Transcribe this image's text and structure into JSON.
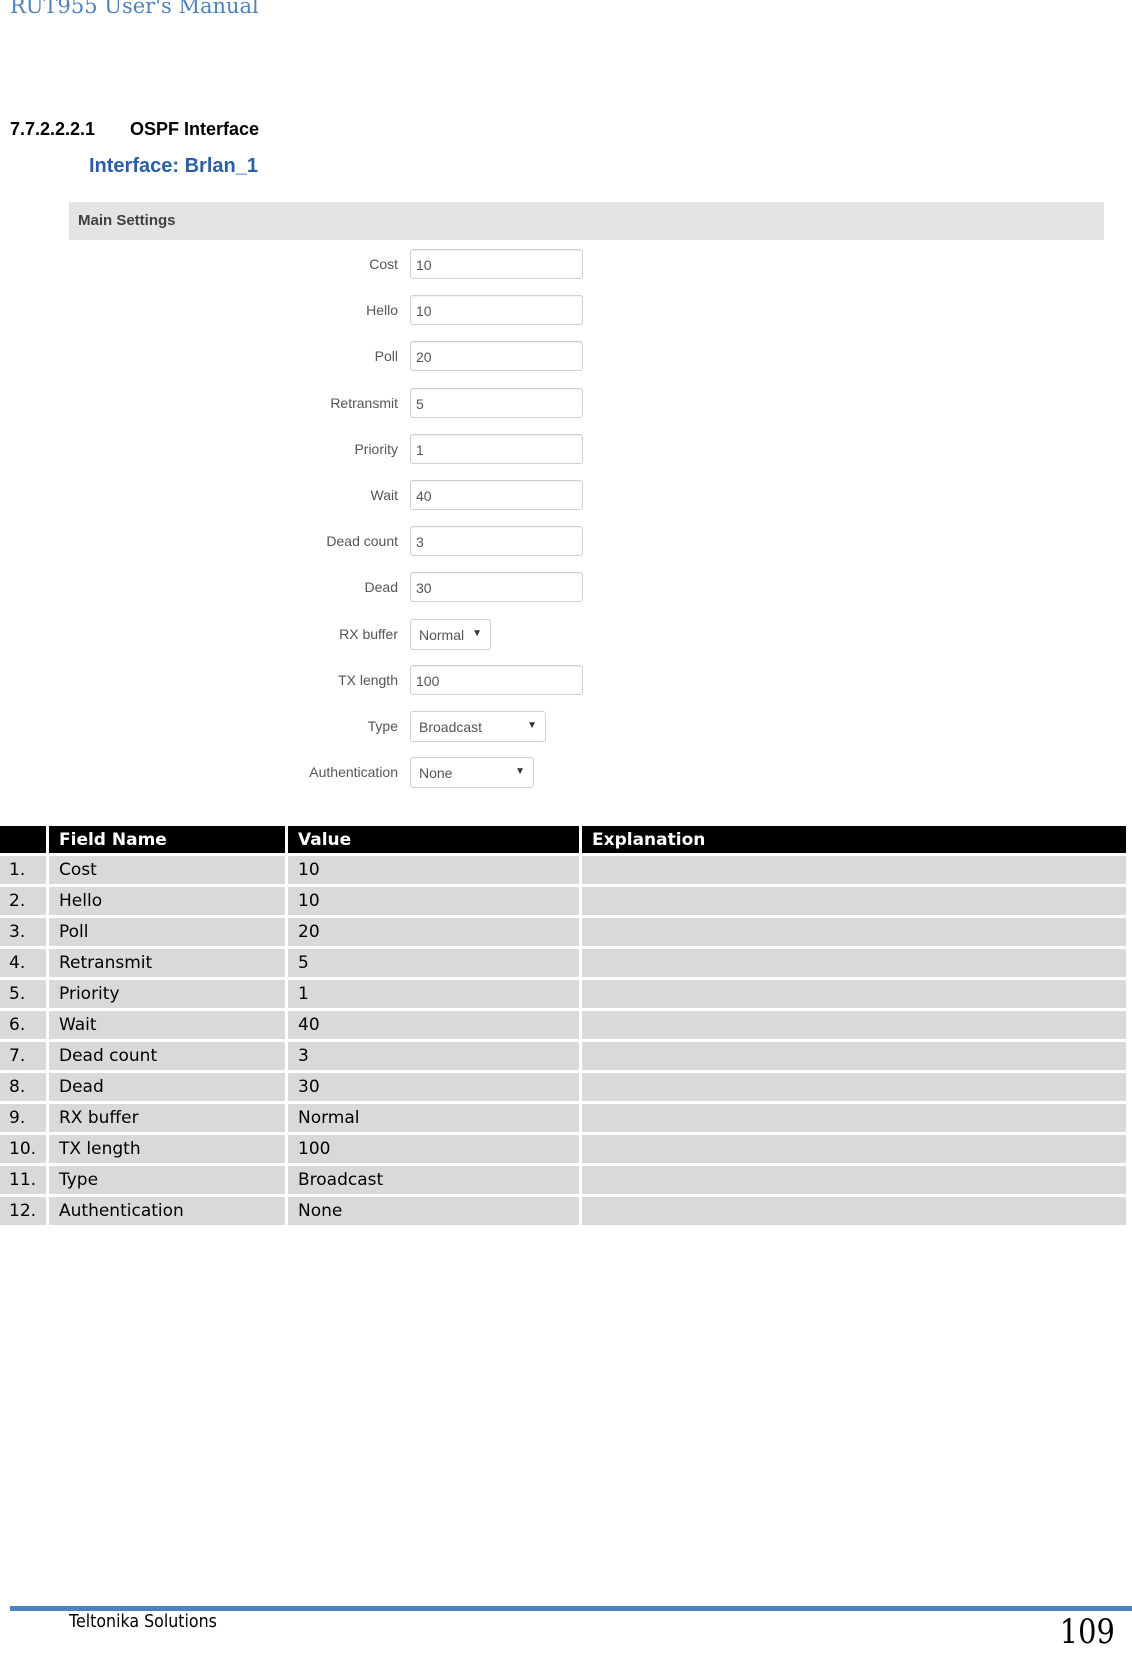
{
  "document": {
    "header_title": "RUT955 User's Manual",
    "footer_company": "Teltonika Solutions",
    "page_number": "109",
    "accent_color": "#4f81bd"
  },
  "section": {
    "number": "7.7.2.2.2.1",
    "title": "OSPF Interface"
  },
  "screenshot": {
    "title": "Interface: Brlan_1",
    "title_color": "#2a5ea8",
    "panel_title": "Main Settings",
    "fields": [
      {
        "label": "Cost",
        "value": "10",
        "kind": "input"
      },
      {
        "label": "Hello",
        "value": "10",
        "kind": "input"
      },
      {
        "label": "Poll",
        "value": "20",
        "kind": "input"
      },
      {
        "label": "Retransmit",
        "value": "5",
        "kind": "input"
      },
      {
        "label": "Priority",
        "value": "1",
        "kind": "input"
      },
      {
        "label": "Wait",
        "value": "40",
        "kind": "input"
      },
      {
        "label": "Dead count",
        "value": "3",
        "kind": "input"
      },
      {
        "label": "Dead",
        "value": "30",
        "kind": "input"
      },
      {
        "label": "RX buffer",
        "value": "Normal",
        "kind": "select"
      },
      {
        "label": "TX length",
        "value": "100",
        "kind": "input"
      },
      {
        "label": "Type",
        "value": "Broadcast",
        "kind": "select"
      },
      {
        "label": "Authentication",
        "value": "None",
        "kind": "select"
      }
    ],
    "dropdown_icon": "▼"
  },
  "table": {
    "headers": [
      "",
      "Field Name",
      "Value",
      "Explanation"
    ],
    "rows": [
      {
        "num": "1.",
        "field": "Cost",
        "value": "10",
        "explanation": ""
      },
      {
        "num": "2.",
        "field": "Hello",
        "value": "10",
        "explanation": ""
      },
      {
        "num": "3.",
        "field": "Poll",
        "value": "20",
        "explanation": ""
      },
      {
        "num": "4.",
        "field": "Retransmit",
        "value": "5",
        "explanation": ""
      },
      {
        "num": "5.",
        "field": "Priority",
        "value": "1",
        "explanation": ""
      },
      {
        "num": "6.",
        "field": "Wait",
        "value": "40",
        "explanation": ""
      },
      {
        "num": "7.",
        "field": "Dead count",
        "value": "3",
        "explanation": ""
      },
      {
        "num": "8.",
        "field": "Dead",
        "value": "30",
        "explanation": ""
      },
      {
        "num": "9.",
        "field": "RX buffer",
        "value": "Normal",
        "explanation": ""
      },
      {
        "num": "10.",
        "field": "TX length",
        "value": "100",
        "explanation": ""
      },
      {
        "num": "11.",
        "field": "Type",
        "value": "Broadcast",
        "explanation": ""
      },
      {
        "num": "12.",
        "field": "Authentication",
        "value": "None",
        "explanation": ""
      }
    ]
  }
}
